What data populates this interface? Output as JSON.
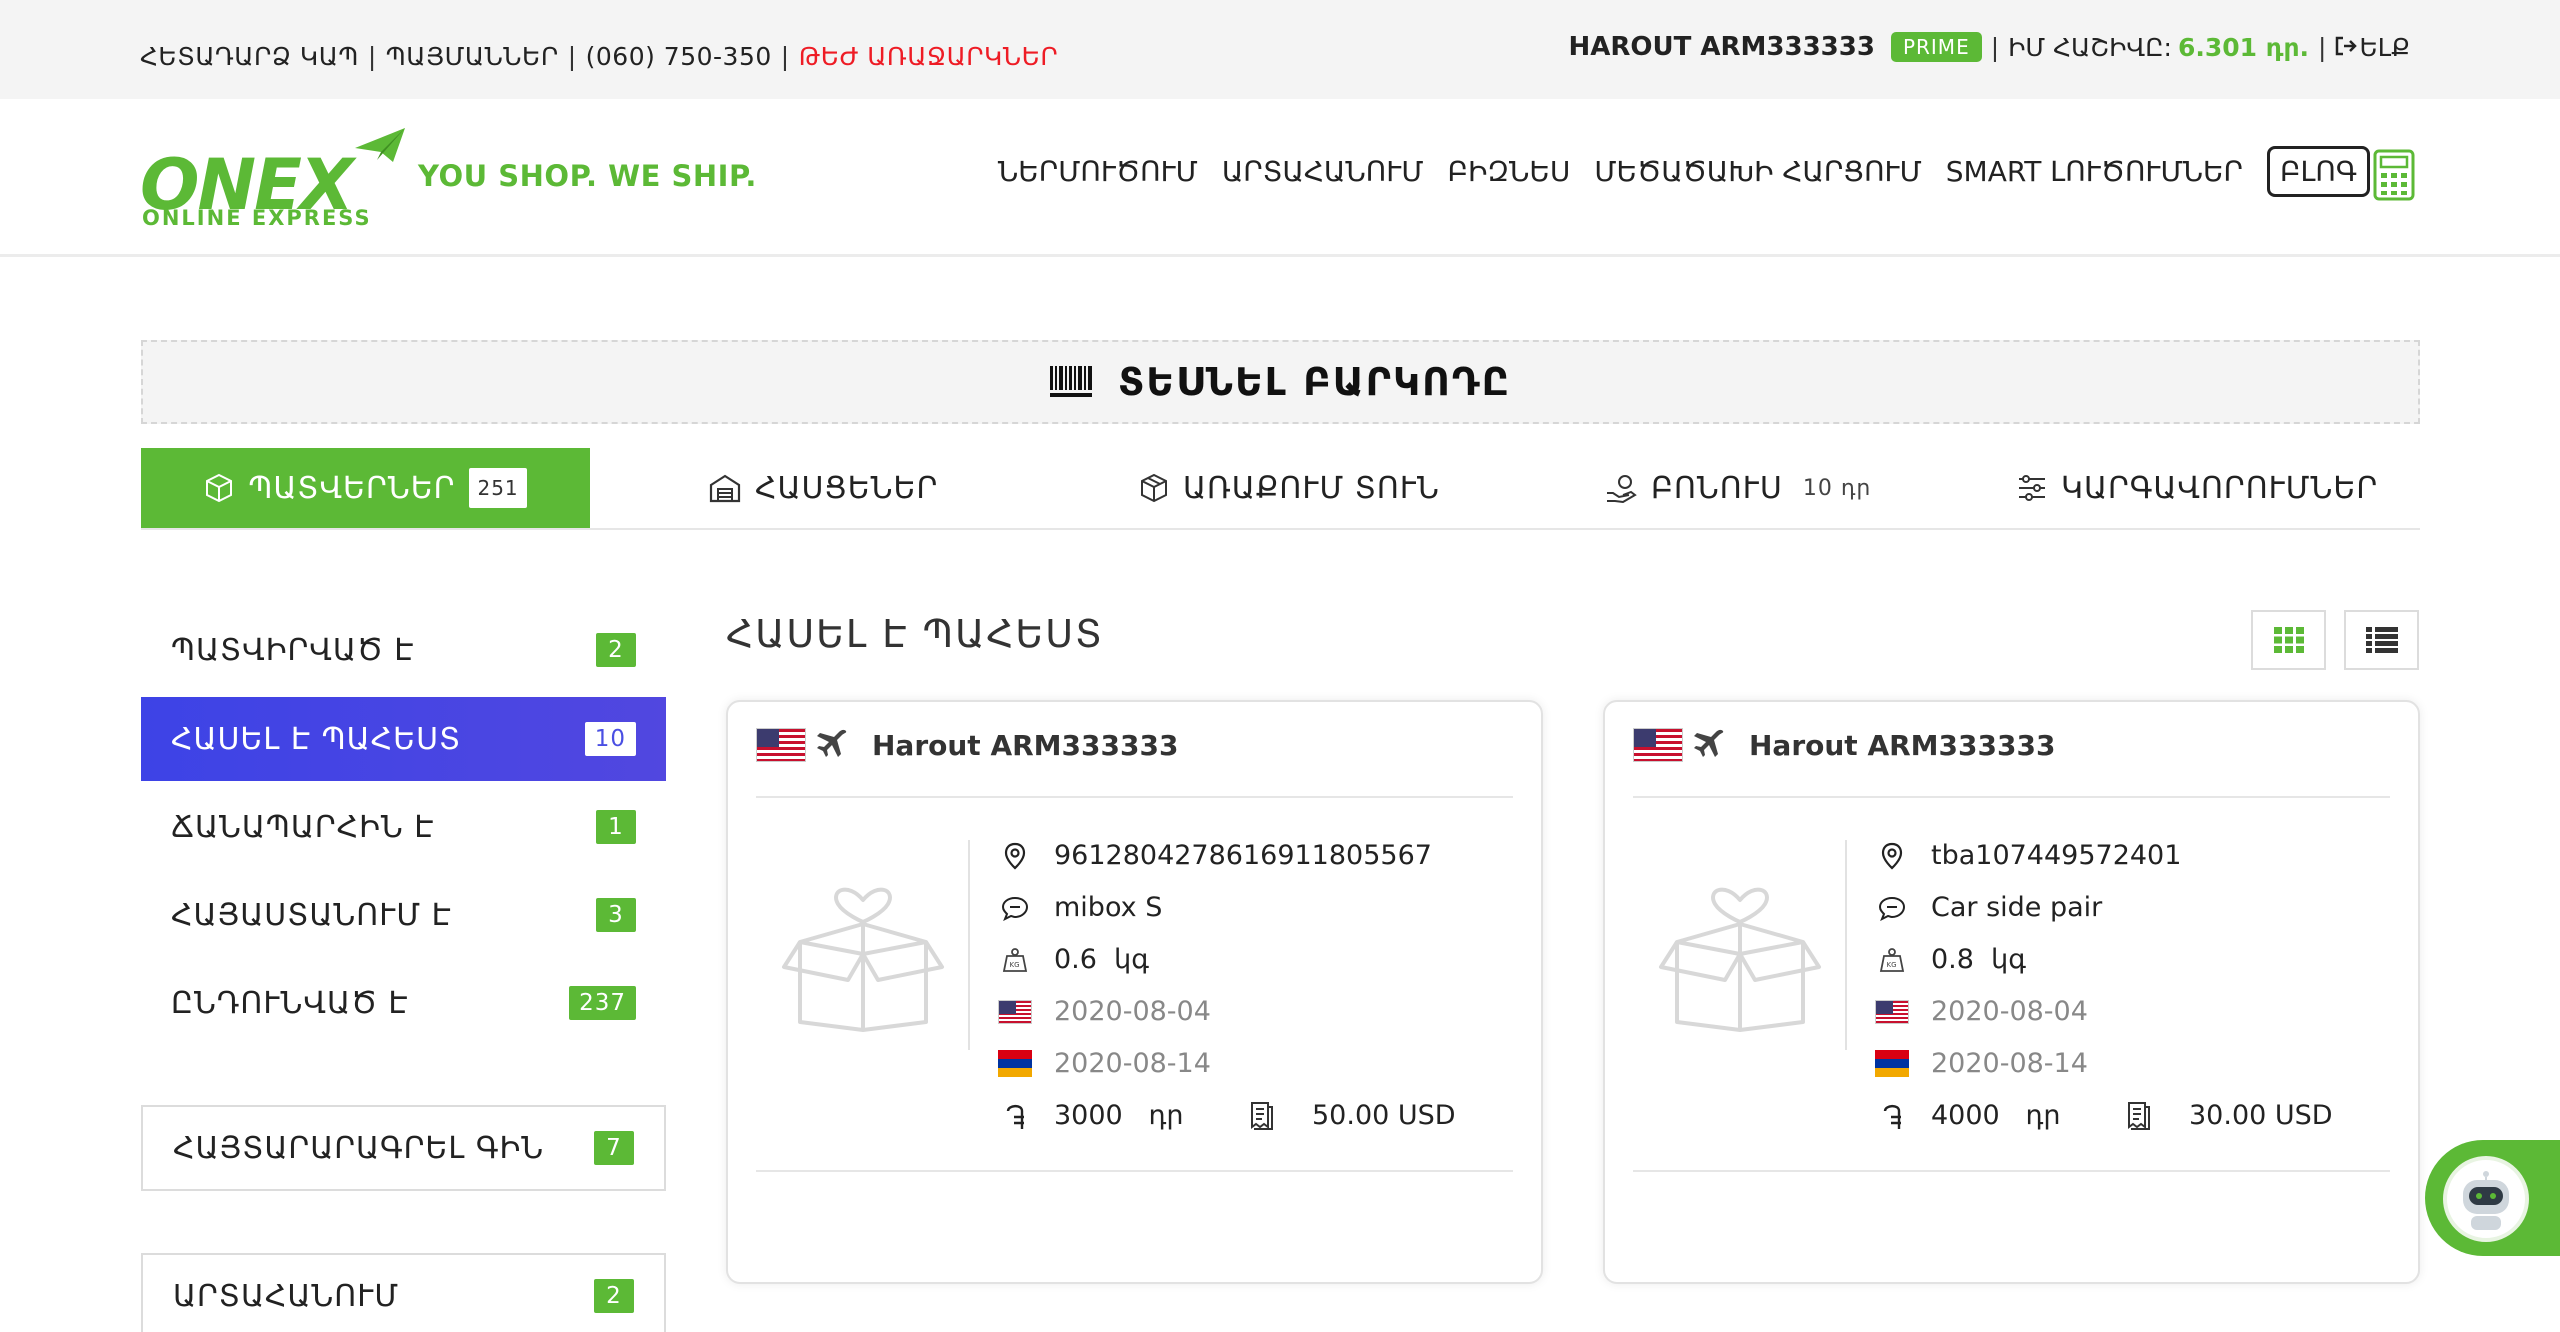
{
  "topbar": {
    "links": [
      "ՀԵՏԱԴԱՐՁ ԿԱՊ",
      "ՊԱՅՄԱՆՆԵՐ",
      "(060) 750-350"
    ],
    "hot_offers": "ԹԵԺ ԱՌԱՋԱՐԿՆԵՐ",
    "user_name": "HAROUT ARM333333",
    "badge": "PRIME",
    "account_label": "ԻՄ ՀԱՇԻՎԸ:",
    "balance": "6.301 դր.",
    "logout": "ԵԼՔ",
    "separator": "|"
  },
  "header": {
    "logo_text": "ONEX",
    "logo_sub": "ONLINE EXPRESS",
    "slogan": "YOU SHOP. WE SHIP.",
    "nav": [
      "ՆԵՐՄՈՒԾՈՒՄ",
      "ԱՐՏԱՀԱՆՈՒՄ",
      "ԲԻԶՆԵՍ",
      "ՄԵԾԱԾԱԽԻ ՀԱՐՑՈՒՄ",
      "SMART ԼՈՒԾՈՒՄՆԵՐ"
    ],
    "blog": "ԲԼՈԳ",
    "calculator_icon": "calculator-icon"
  },
  "barcode": {
    "label": "ՏԵՍՆԵԼ ԲԱՐԿՈԴԸ",
    "icon": "barcode-icon"
  },
  "tabs": [
    {
      "label": "ՊԱՏՎԵՐՆԵՐ",
      "count": "251",
      "icon": "package-icon"
    },
    {
      "label": "ՀԱՍՑԵՆԵՐ",
      "icon": "warehouse-icon"
    },
    {
      "label": "ԱՌԱՔՈՒՄ ՏՈՒՆ",
      "icon": "delivery-box-icon"
    },
    {
      "label": "ԲՈՆՈՒՍ",
      "extra": "10 դր",
      "icon": "bonus-hand-icon"
    },
    {
      "label": "ԿԱՐԳԱՎՈՐՈՒՄՆԵՐ",
      "icon": "sliders-icon"
    }
  ],
  "sidebar": {
    "statuses": [
      {
        "label": "ՊԱՏՎԻՐՎԱԾ Է",
        "count": "2"
      },
      {
        "label": "ՀԱՍԵԼ Է ՊԱՀԵՍՏ",
        "count": "10"
      },
      {
        "label": "ՃԱՆԱՊԱՐՀԻՆ Է",
        "count": "1"
      },
      {
        "label": "ՀԱՅԱՍՏԱՆՈՒՄ Է",
        "count": "3"
      },
      {
        "label": "ԸՆԴՈՒՆՎԱԾ Է",
        "count": "237"
      }
    ],
    "declare": {
      "label": "ՀԱՅՏԱՐԱՐԱԳՐԵԼ ԳԻՆ",
      "count": "7"
    },
    "export": {
      "label": "ԱՐՏԱՀԱՆՈՒՄ",
      "count": "2"
    }
  },
  "main": {
    "title": "ՀԱՍԵԼ Է ՊԱՀԵՍՏ",
    "view_grid_icon": "grid-view-icon",
    "view_list_icon": "list-view-icon",
    "cards": [
      {
        "name": "Harout ARM333333",
        "tracking": "9612804278616911805567",
        "description": "mibox S",
        "weight": "0.6",
        "weight_unit": "կգ",
        "date_us": "2020-08-04",
        "date_am": "2020-08-14",
        "price": "3000",
        "price_unit": "դր",
        "invoice": "50.00 USD"
      },
      {
        "name": "Harout ARM333333",
        "tracking": "tba107449572401",
        "description": "Car side pair",
        "weight": "0.8",
        "weight_unit": "կգ",
        "date_us": "2020-08-04",
        "date_am": "2020-08-14",
        "price": "4000",
        "price_unit": "դր",
        "invoice": "30.00 USD"
      }
    ]
  },
  "colors": {
    "brand_green": "#5cb936",
    "active_blue": "#4146e4",
    "hot_red": "#ee1c25"
  }
}
